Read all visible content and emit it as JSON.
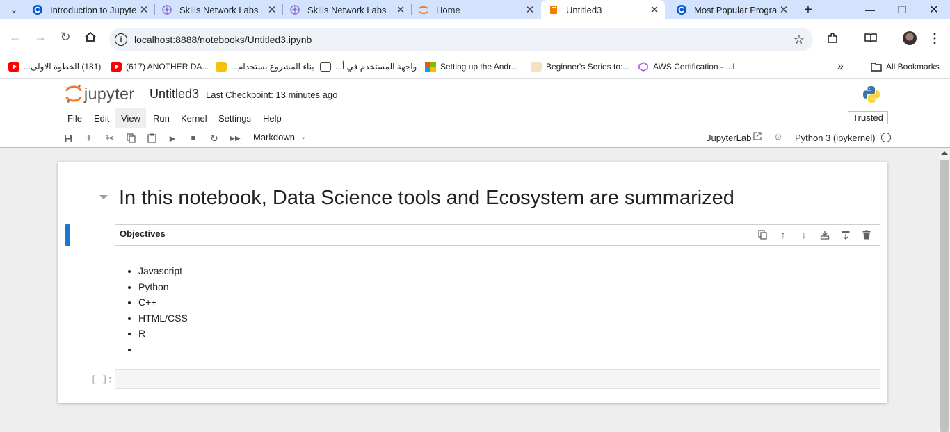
{
  "browser": {
    "tabs": [
      {
        "title": "Introduction to Jupyte",
        "icon": "coursera-icon",
        "active": false
      },
      {
        "title": "Skills Network Labs",
        "icon": "skills-network-icon",
        "active": false
      },
      {
        "title": "Skills Network Labs",
        "icon": "skills-network-icon",
        "active": false
      },
      {
        "title": "Home",
        "icon": "jupyter-icon",
        "active": false
      },
      {
        "title": "Untitled3",
        "icon": "notebook-icon",
        "active": true
      },
      {
        "title": "Most Popular Prograr",
        "icon": "coursera-icon",
        "active": false
      }
    ],
    "url": "localhost:8888/notebooks/Untitled3.ipynb",
    "bookmarks": [
      {
        "label": "(181) الخطوة الاولى...",
        "icon": "youtube-icon"
      },
      {
        "label": "(617) ANOTHER DA...",
        "icon": "youtube-icon"
      },
      {
        "label": "بناء المشروع بستخدام...",
        "icon": "bookmark-icon"
      },
      {
        "label": "واجهة المستخدم في أ...",
        "icon": "bookmark-icon"
      },
      {
        "label": "Setting up the Andr...",
        "icon": "microsoft-icon"
      },
      {
        "label": "Beginner's Series to:...",
        "icon": "bookmark-icon"
      },
      {
        "label": "AWS Certification - ...I",
        "icon": "aws-icon"
      }
    ],
    "all_bookmarks_label": "All Bookmarks",
    "colors": {
      "tabstrip": "#d3e3fd",
      "active_tab": "#ffffff"
    }
  },
  "jupyter": {
    "logo_text": "jupyter",
    "notebook_title": "Untitled3",
    "checkpoint": "Last Checkpoint: 13 minutes ago",
    "menus": [
      "File",
      "Edit",
      "View",
      "Run",
      "Kernel",
      "Settings",
      "Help"
    ],
    "trusted_label": "Trusted",
    "cell_type": "Markdown",
    "jupyterlab_label": "JupyterLab",
    "kernel_name": "Python 3 (ipykernel)",
    "accent_color": "#1976d2"
  },
  "notebook": {
    "heading": "In this notebook, Data Science tools and Ecosystem are summarized",
    "markdown_cell_text": "Objectives",
    "objectives": [
      "Javascript",
      "Python",
      "C++",
      "HTML/CSS",
      "R",
      ""
    ],
    "code_prompt": "[ ]:"
  }
}
